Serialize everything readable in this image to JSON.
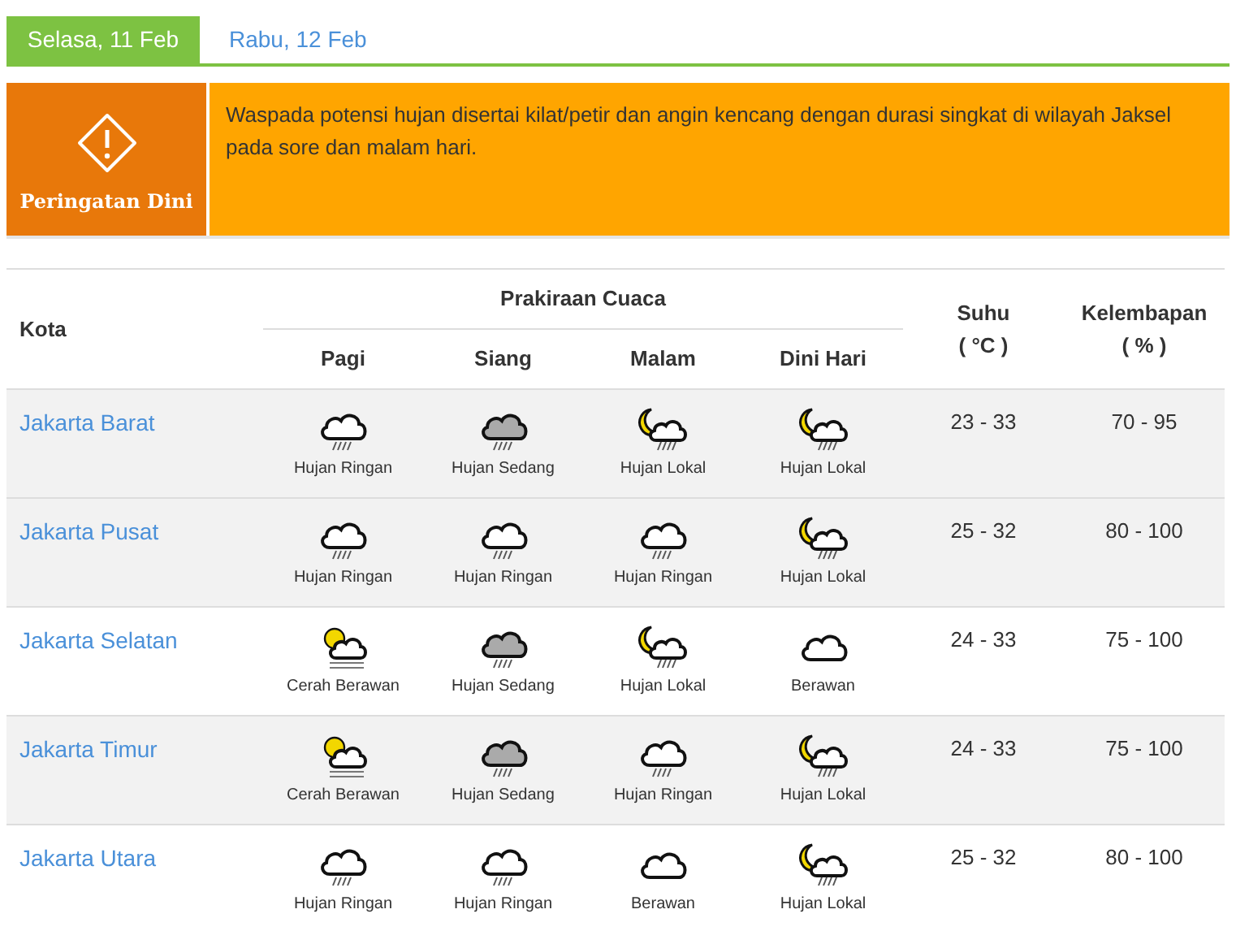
{
  "tabs": [
    {
      "label": "Selasa, 11 Feb",
      "selected": true
    },
    {
      "label": "Rabu, 12 Feb",
      "selected": false
    }
  ],
  "warning": {
    "title": "Peringatan Dini",
    "message": "Waspada potensi hujan disertai kilat/petir dan angin kencang dengan durasi singkat di wilayah Jaksel pada sore dan malam hari."
  },
  "table": {
    "columns": {
      "city": "Kota",
      "forecast": "Prakiraan Cuaca",
      "periods": [
        "Pagi",
        "Siang",
        "Malam",
        "Dini Hari"
      ],
      "temp": "Suhu",
      "temp_unit": "( °C )",
      "humidity": "Kelembapan",
      "humidity_unit": "( % )"
    },
    "rows": [
      {
        "city": "Jakarta Barat",
        "shaded": true,
        "forecasts": [
          {
            "kind": "light-rain",
            "label": "Hujan Ringan"
          },
          {
            "kind": "moderate-rain",
            "label": "Hujan Sedang"
          },
          {
            "kind": "local-rain",
            "label": "Hujan Lokal"
          },
          {
            "kind": "local-rain",
            "label": "Hujan Lokal"
          }
        ],
        "temp": "23 - 33",
        "humidity": "70 - 95"
      },
      {
        "city": "Jakarta Pusat",
        "shaded": true,
        "forecasts": [
          {
            "kind": "light-rain",
            "label": "Hujan Ringan"
          },
          {
            "kind": "light-rain",
            "label": "Hujan Ringan"
          },
          {
            "kind": "light-rain",
            "label": "Hujan Ringan"
          },
          {
            "kind": "local-rain",
            "label": "Hujan Lokal"
          }
        ],
        "temp": "25 - 32",
        "humidity": "80 - 100"
      },
      {
        "city": "Jakarta Selatan",
        "shaded": false,
        "forecasts": [
          {
            "kind": "partly-sunny",
            "label": "Cerah Berawan"
          },
          {
            "kind": "moderate-rain",
            "label": "Hujan Sedang"
          },
          {
            "kind": "local-rain",
            "label": "Hujan Lokal"
          },
          {
            "kind": "cloudy",
            "label": "Berawan"
          }
        ],
        "temp": "24 - 33",
        "humidity": "75 - 100"
      },
      {
        "city": "Jakarta Timur",
        "shaded": true,
        "forecasts": [
          {
            "kind": "partly-sunny",
            "label": "Cerah Berawan"
          },
          {
            "kind": "moderate-rain",
            "label": "Hujan Sedang"
          },
          {
            "kind": "light-rain",
            "label": "Hujan Ringan"
          },
          {
            "kind": "local-rain",
            "label": "Hujan Lokal"
          }
        ],
        "temp": "24 - 33",
        "humidity": "75 - 100"
      },
      {
        "city": "Jakarta Utara",
        "shaded": false,
        "forecasts": [
          {
            "kind": "light-rain",
            "label": "Hujan Ringan"
          },
          {
            "kind": "light-rain",
            "label": "Hujan Ringan"
          },
          {
            "kind": "cloudy",
            "label": "Berawan"
          },
          {
            "kind": "local-rain",
            "label": "Hujan Lokal"
          }
        ],
        "temp": "25 - 32",
        "humidity": "80 - 100"
      }
    ]
  }
}
